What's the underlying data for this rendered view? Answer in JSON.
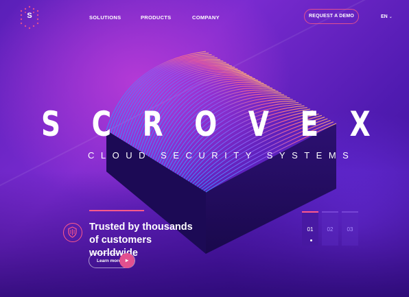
{
  "header": {
    "logo_letter": "S",
    "nav": [
      "SOLUTIONS",
      "PRODUCTS",
      "COMPANY"
    ],
    "cta_label": "REQUEST A DEMO",
    "language": "EN"
  },
  "hero": {
    "title": "SCROVEX",
    "subtitle": "CLOUD SECURITY SYSTEMS",
    "tagline_line1": "Trusted by thousands",
    "tagline_line2": "of customers worldwide",
    "learn_more_label": "Learn more"
  },
  "slides": {
    "items": [
      "01",
      "02",
      "03"
    ],
    "active_index": 0
  },
  "colors": {
    "accent_pink": "#e2508f",
    "background_purple": "#5a1fb8"
  },
  "icons": [
    "hexagon-logo-icon",
    "chevron-down-icon",
    "shield-icon",
    "arrow-right-icon"
  ]
}
